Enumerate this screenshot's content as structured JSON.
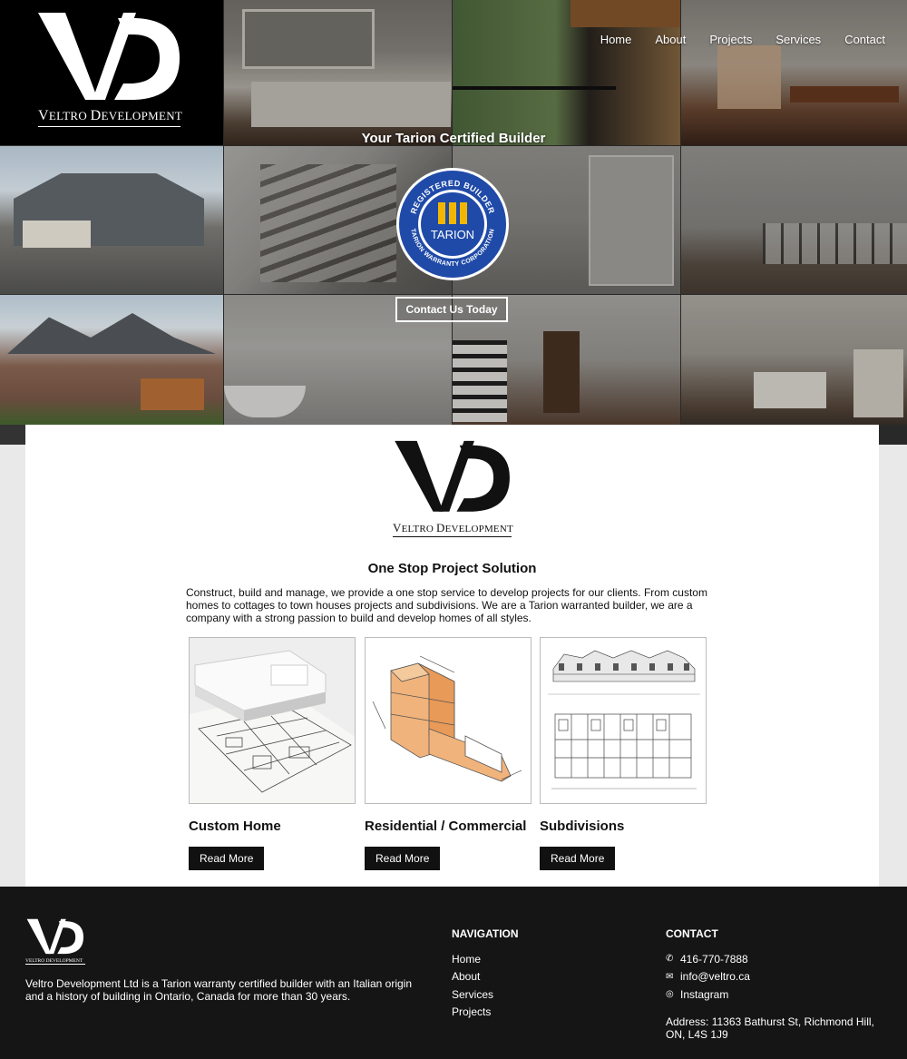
{
  "brand": {
    "logo_letters": "VD",
    "wordmark_first_initial": "V",
    "wordmark_first_rest": "ELTRO",
    "wordmark_second_initial": "D",
    "wordmark_second_rest": "EVELOPMENT"
  },
  "nav": {
    "items": [
      {
        "label": "Home"
      },
      {
        "label": "About"
      },
      {
        "label": "Projects"
      },
      {
        "label": "Services"
      },
      {
        "label": "Contact"
      }
    ]
  },
  "hero": {
    "tagline": "Your Tarion Certified Builder",
    "badge": {
      "top_text": "REGISTERED BUILDER",
      "center_text": "TARION",
      "bottom_text": "TARION WARRANTY CORPORATION",
      "color_blue": "#1f4aa8",
      "color_gold": "#f2b600"
    },
    "cta_label": "Contact Us Today"
  },
  "main": {
    "section_title": "One Stop Project Solution",
    "intro": "Construct, build and manage, we provide a one stop service to develop projects for our clients. From custom homes to cottages to town houses projects and subdivisions. We are a Tarion warranted builder, we are a company with a strong passion to build and develop homes of all styles.",
    "cards": [
      {
        "title": "Custom Home",
        "button": "Read More"
      },
      {
        "title": "Residential / Commercial",
        "button": "Read More"
      },
      {
        "title": "Subdivisions",
        "button": "Read More"
      }
    ]
  },
  "footer": {
    "about": "Veltro Development Ltd is a Tarion warranty certified builder with an Italian origin and a history of building in Ontario, Canada for more than 30 years.",
    "navigation_title": "NAVIGATION",
    "navigation": [
      {
        "label": "Home"
      },
      {
        "label": "About"
      },
      {
        "label": "Services"
      },
      {
        "label": "Projects"
      }
    ],
    "contact_title": "CONTACT",
    "contact": [
      {
        "icon": "phone-icon",
        "glyph": "✆",
        "label": "416-770-7888"
      },
      {
        "icon": "mail-icon",
        "glyph": "✉",
        "label": "info@veltro.ca"
      },
      {
        "icon": "instagram-icon",
        "glyph": "◎",
        "label": "Instagram"
      }
    ],
    "address": "Address: 11363 Bathurst St, Richmond Hill, ON, L4S 1J9"
  },
  "colors": {
    "dark": "#111111",
    "footer_bg": "#151515",
    "page_bg": "#e9e9e9"
  }
}
